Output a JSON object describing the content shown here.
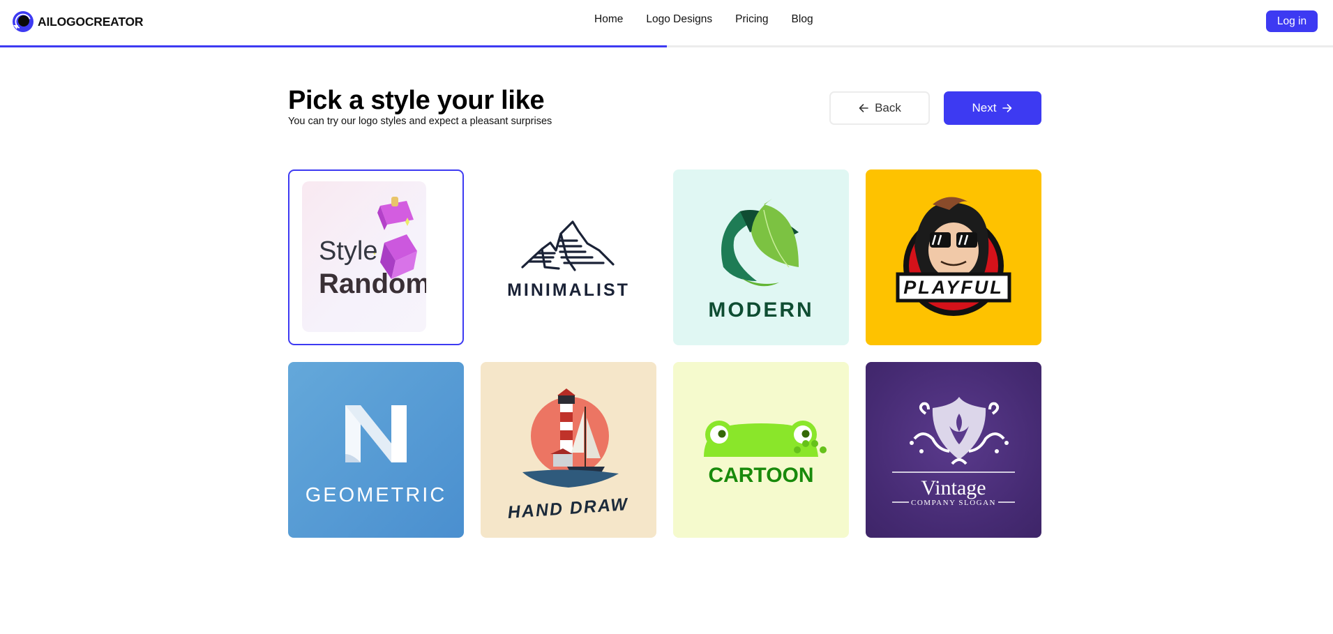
{
  "header": {
    "brand_name": "AILOGOCREATOR",
    "brand_icon": "ailogocreator-logo-icon",
    "nav": [
      {
        "label": "Home"
      },
      {
        "label": "Logo Designs"
      },
      {
        "label": "Pricing"
      },
      {
        "label": "Blog"
      }
    ],
    "login_label": "Log in"
  },
  "progress": {
    "fraction": 0.5
  },
  "page": {
    "title": "Pick a style your like",
    "subtitle": "You can try our logo styles and expect a pleasant surprises",
    "back_label": "Back",
    "back_icon": "arrow-left-icon",
    "next_label": "Next",
    "next_icon": "arrow-right-icon"
  },
  "styles": [
    {
      "name": "random",
      "line1": "Style",
      "line2": "Random",
      "selected": true,
      "bg": "#ffffff"
    },
    {
      "name": "minimalist",
      "label": "MINIMALIST",
      "selected": false,
      "bg": "#ffffff",
      "accent": "#1a2236"
    },
    {
      "name": "modern",
      "label": "MODERN",
      "selected": false,
      "bg": "#e0f7f3",
      "accent": "#0f4d32"
    },
    {
      "name": "playful",
      "label": "PLAYFUL",
      "selected": false,
      "bg": "#fec200",
      "accent": "#111111"
    },
    {
      "name": "geometric",
      "label": "GEOMETRIC",
      "selected": false,
      "bg": "#5aa0d6",
      "accent": "#ffffff"
    },
    {
      "name": "hand-draw",
      "label": "HAND DRAW",
      "selected": false,
      "bg": "#f5e6c9",
      "accent": "#1b2a3a"
    },
    {
      "name": "cartoon",
      "label": "CARTOON",
      "selected": false,
      "bg": "#f5facd",
      "accent": "#188a0b"
    },
    {
      "name": "vintage",
      "label": "Vintage",
      "sublabel": "COMPANY SLOGAN",
      "selected": false,
      "bg": "#4b2d78",
      "accent": "#ffffff"
    }
  ],
  "colors": {
    "primary": "#3d3af2",
    "border": "#ececec"
  }
}
